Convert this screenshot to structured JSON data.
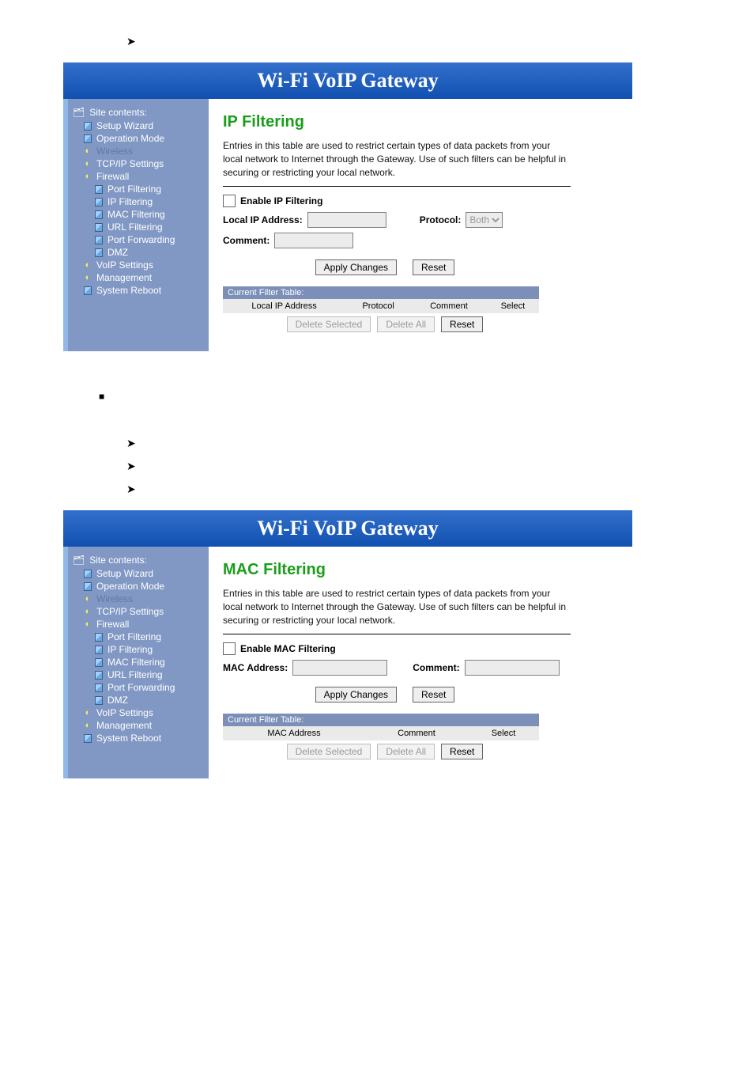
{
  "bullets": {
    "arrow": "➤",
    "square": "■"
  },
  "banner": "Wi-Fi  VoIP  Gateway",
  "sidebar": {
    "root": "Site contents:",
    "items": [
      {
        "kind": "page",
        "label": "Setup Wizard"
      },
      {
        "kind": "page",
        "label": "Operation Mode"
      },
      {
        "kind": "folder",
        "label": "Wireless",
        "dim": true
      },
      {
        "kind": "folder",
        "label": "TCP/IP Settings"
      },
      {
        "kind": "folder",
        "label": "Firewall"
      },
      {
        "kind": "sub",
        "label": "Port Filtering"
      },
      {
        "kind": "sub",
        "label": "IP Filtering"
      },
      {
        "kind": "sub",
        "label": "MAC Filtering"
      },
      {
        "kind": "sub",
        "label": "URL Filtering"
      },
      {
        "kind": "sub",
        "label": "Port Forwarding"
      },
      {
        "kind": "sub",
        "label": "DMZ"
      },
      {
        "kind": "folder",
        "label": "VoIP Settings"
      },
      {
        "kind": "folder",
        "label": "Management"
      },
      {
        "kind": "page",
        "label": "System Reboot"
      }
    ]
  },
  "panel1": {
    "title": "IP Filtering",
    "desc": "Entries in this table are used to restrict certain types of data packets from your local network to Internet through the Gateway. Use of such filters can be helpful in securing or restricting your local network.",
    "enable_label": "Enable IP Filtering",
    "ip_label": "Local IP Address:",
    "proto_label": "Protocol:",
    "proto_opts": [
      "Both"
    ],
    "comment_label": "Comment:",
    "apply": "Apply Changes",
    "reset": "Reset",
    "table_title": "Current Filter Table:",
    "cols": [
      "Local IP Address",
      "Protocol",
      "Comment",
      "Select"
    ],
    "del_sel": "Delete Selected",
    "del_all": "Delete All"
  },
  "panel2": {
    "title": "MAC Filtering",
    "desc": "Entries in this table are used to restrict certain types of data packets from your local network to Internet through the Gateway. Use of such filters can be helpful in securing or restricting your local network.",
    "enable_label": "Enable MAC Filtering",
    "mac_label": "MAC Address:",
    "comment_label": "Comment:",
    "apply": "Apply Changes",
    "reset": "Reset",
    "table_title": "Current Filter Table:",
    "cols": [
      "MAC Address",
      "Comment",
      "Select"
    ],
    "del_sel": "Delete Selected",
    "del_all": "Delete All"
  }
}
